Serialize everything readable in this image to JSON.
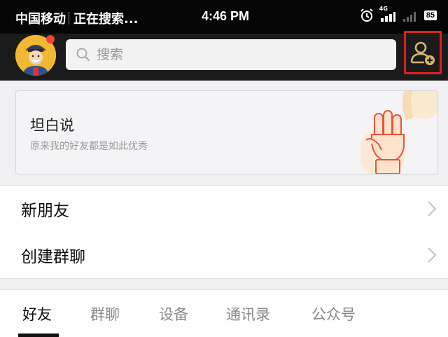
{
  "status_bar": {
    "carrier": "中国移动",
    "activity": "正在搜索...",
    "time": "4:46 PM",
    "network": "4G",
    "battery": "85"
  },
  "header": {
    "search_placeholder": "搜索",
    "add_friend_icon": "add-friend-icon"
  },
  "banner": {
    "title": "坦白说",
    "subtitle": "原来我的好友都是如此优秀"
  },
  "menu": [
    {
      "label": "新朋友"
    },
    {
      "label": "创建群聊"
    }
  ],
  "tabs": [
    {
      "label": "好友",
      "active": true
    },
    {
      "label": "群聊"
    },
    {
      "label": "设备"
    },
    {
      "label": "通讯录"
    },
    {
      "label": "公众号"
    }
  ],
  "colors": {
    "header_bg": "#1b1b1b",
    "highlight_border": "#e02020",
    "avatar_badge": "#f44336"
  }
}
